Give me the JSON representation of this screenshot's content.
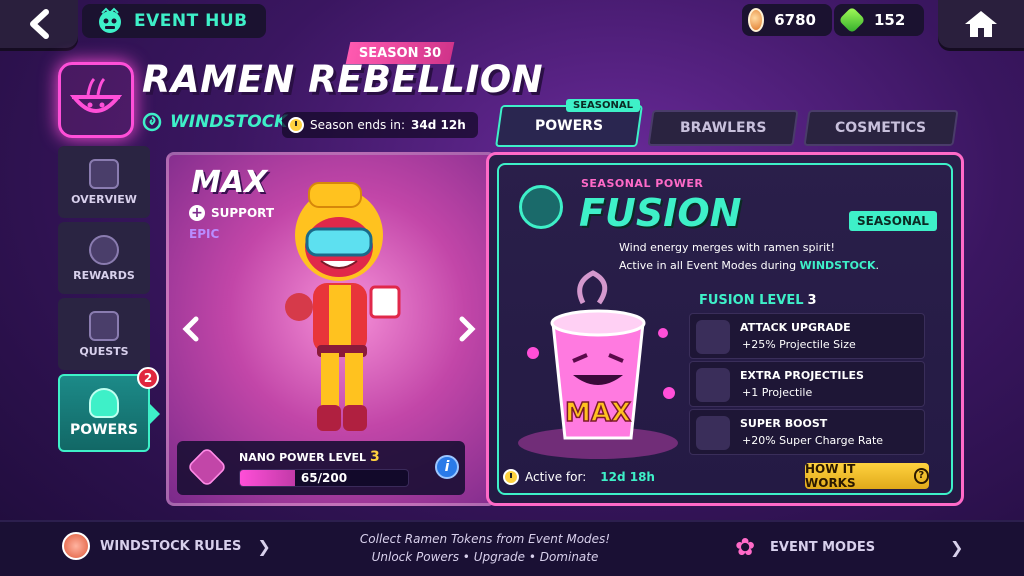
{
  "header": {
    "hub_label": "EVENT HUB",
    "coins": "6780",
    "gems": "152",
    "icons": [
      "back-arrow-icon",
      "hub-mascot-icon",
      "coin-icon",
      "gem-icon",
      "home-icon"
    ]
  },
  "event": {
    "season": "SEASON 30",
    "title": "RAMEN REBELLION",
    "location": "WINDSTOCK",
    "season_ends_label": "Season ends in:",
    "season_ends_value": "34d 12h"
  },
  "tabs": {
    "seasonal_tag": "SEASONAL",
    "powers": "POWERS",
    "brawlers": "BRAWLERS",
    "cosmetics": "COSMETICS"
  },
  "sidenav": {
    "overview": "OVERVIEW",
    "rewards": "REWARDS",
    "quests": "QUESTS",
    "powers": "POWERS",
    "powers_badge": "2"
  },
  "brawler": {
    "name": "MAX",
    "role": "SUPPORT",
    "rarity": "EPIC",
    "nano_label": "NANO POWER LEVEL",
    "nano_level": "3",
    "nano_progress_text": "65/200",
    "nano_progress_fraction": 0.325
  },
  "power": {
    "type_label": "SEASONAL POWER",
    "name": "FUSION",
    "badge": "SEASONAL",
    "desc_line1": "Wind energy merges with ramen spirit!",
    "desc_line2_prefix": "Active in all Event Modes during",
    "desc_line2_highlight": "WINDSTOCK",
    "desc_line2_suffix": ".",
    "cup_text": "MAX",
    "level_label": "FUSION LEVEL",
    "level_value": "3",
    "upgrades": [
      {
        "title": "ATTACK UPGRADE",
        "desc": "+25% Projectile Size",
        "icon": "projectile-icon"
      },
      {
        "title": "EXTRA PROJECTILES",
        "desc": "+1 Projectile",
        "icon": "multi-projectile-icon"
      },
      {
        "title": "SUPER BOOST",
        "desc": "+20% Super Charge Rate",
        "icon": "skull-icon"
      }
    ],
    "active_label": "Active for:",
    "active_value": "12d 18h",
    "how_button": "HOW IT WORKS"
  },
  "footer": {
    "rules": "WINDSTOCK RULES",
    "message_line1": "Collect Ramen Tokens from Event Modes!",
    "message_line2": "Unlock Powers • Upgrade • Dominate",
    "modes": "EVENT MODES"
  },
  "colors": {
    "accent_teal": "#3ef0c8",
    "accent_pink": "#ff6ac8",
    "accent_gold": "#ffd23f"
  }
}
